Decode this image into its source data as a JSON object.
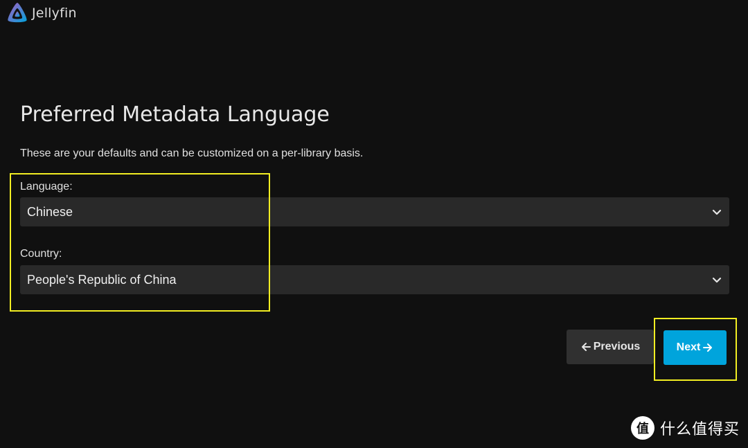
{
  "header": {
    "brand": "Jellyfin",
    "logo_icon": "jellyfin-logo-icon",
    "logo_colors": [
      "#aa5cc3",
      "#00a4dc"
    ]
  },
  "main": {
    "title": "Preferred Metadata Language",
    "description": "These are your defaults and can be customized on a per-library basis.",
    "fields": [
      {
        "label": "Language:",
        "value": "Chinese",
        "icon": "chevron-down-icon"
      },
      {
        "label": "Country:",
        "value": "People's Republic of China",
        "icon": "chevron-down-icon"
      }
    ]
  },
  "buttons": {
    "previous": {
      "label": "Previous",
      "icon": "arrow-left-icon"
    },
    "next": {
      "label": "Next",
      "icon": "arrow-right-icon"
    }
  },
  "watermark": {
    "badge": "值",
    "text": "什么值得买"
  },
  "colors": {
    "background": "#101010",
    "select_background": "#292929",
    "accent": "#00a4dc",
    "secondary_button": "#303030",
    "highlight": "#f2ee22"
  }
}
